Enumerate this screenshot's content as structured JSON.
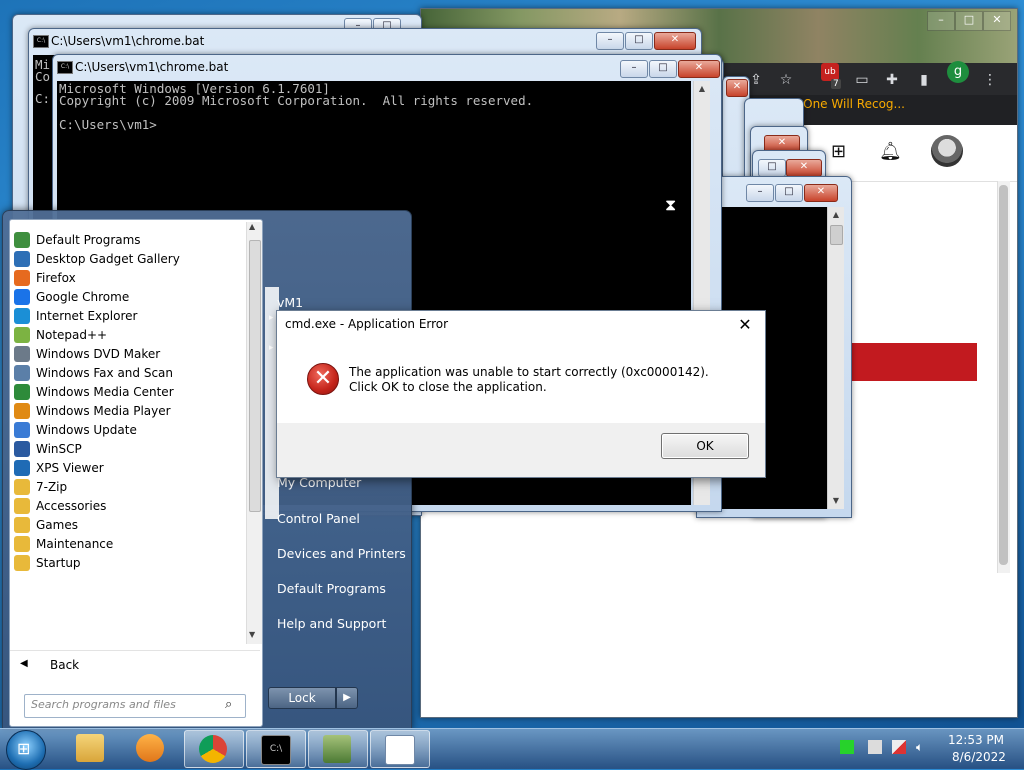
{
  "browser": {
    "bookmark_label": "No One Will Recog...",
    "ext_count": "7",
    "profile_letter": "g"
  },
  "cmd_back": {
    "title": "C:\\Users\\vm1\\chrome.bat",
    "peek_lines": [
      "Mi",
      "Co",
      "C:"
    ]
  },
  "cmd_front": {
    "title": "C:\\Users\\vm1\\chrome.bat",
    "lines": [
      "Microsoft Windows [Version 6.1.7601]",
      "Copyright (c) 2009 Microsoft Corporation.  All rights reserved.",
      "",
      "C:\\Users\\vm1>"
    ]
  },
  "start_menu": {
    "programs": [
      {
        "label": "Default Programs",
        "icon": "default-programs-icon",
        "color": "#3f8f3f"
      },
      {
        "label": "Desktop Gadget Gallery",
        "icon": "gadget-icon",
        "color": "#2d6fb6"
      },
      {
        "label": "Firefox",
        "icon": "firefox-icon",
        "color": "#e66a1f"
      },
      {
        "label": "Google Chrome",
        "icon": "chrome-icon",
        "color": "#1a73e8"
      },
      {
        "label": "Internet Explorer",
        "icon": "internet-explorer-icon",
        "color": "#1b8fd6"
      },
      {
        "label": "Notepad++",
        "icon": "notepadpp-icon",
        "color": "#7cb342"
      },
      {
        "label": "Windows DVD Maker",
        "icon": "dvd-maker-icon",
        "color": "#6c7a89"
      },
      {
        "label": "Windows Fax and Scan",
        "icon": "fax-icon",
        "color": "#5b7fa8"
      },
      {
        "label": "Windows Media Center",
        "icon": "media-center-icon",
        "color": "#2e8b3a"
      },
      {
        "label": "Windows Media Player",
        "icon": "media-player-icon",
        "color": "#e08a14"
      },
      {
        "label": "Windows Update",
        "icon": "windows-update-icon",
        "color": "#3a7bd5"
      },
      {
        "label": "WinSCP",
        "icon": "winscp-icon",
        "color": "#2b5aa0"
      },
      {
        "label": "XPS Viewer",
        "icon": "xps-viewer-icon",
        "color": "#1f6bb5"
      },
      {
        "label": "7-Zip",
        "icon": "folder-icon",
        "color": "#e8b93a"
      },
      {
        "label": "Accessories",
        "icon": "folder-icon",
        "color": "#e8b93a"
      },
      {
        "label": "Games",
        "icon": "folder-icon",
        "color": "#e8b93a"
      },
      {
        "label": "Maintenance",
        "icon": "folder-icon",
        "color": "#e8b93a"
      },
      {
        "label": "Startup",
        "icon": "folder-icon",
        "color": "#e8b93a"
      }
    ],
    "back_label": "Back",
    "search_placeholder": "Search programs and files",
    "right_links": {
      "user": "vM1",
      "computer": "My Computer",
      "control_panel": "Control Panel",
      "devices": "Devices and Printers",
      "default_programs": "Default Programs",
      "help": "Help and Support"
    },
    "lock_label": "Lock"
  },
  "dialog": {
    "title": "cmd.exe - Application Error",
    "message": "The application was unable to start correctly (0xc0000142). Click OK to close the application.",
    "ok_label": "OK"
  },
  "taskbar": {
    "time": "12:53 PM",
    "date": "8/6/2022"
  }
}
